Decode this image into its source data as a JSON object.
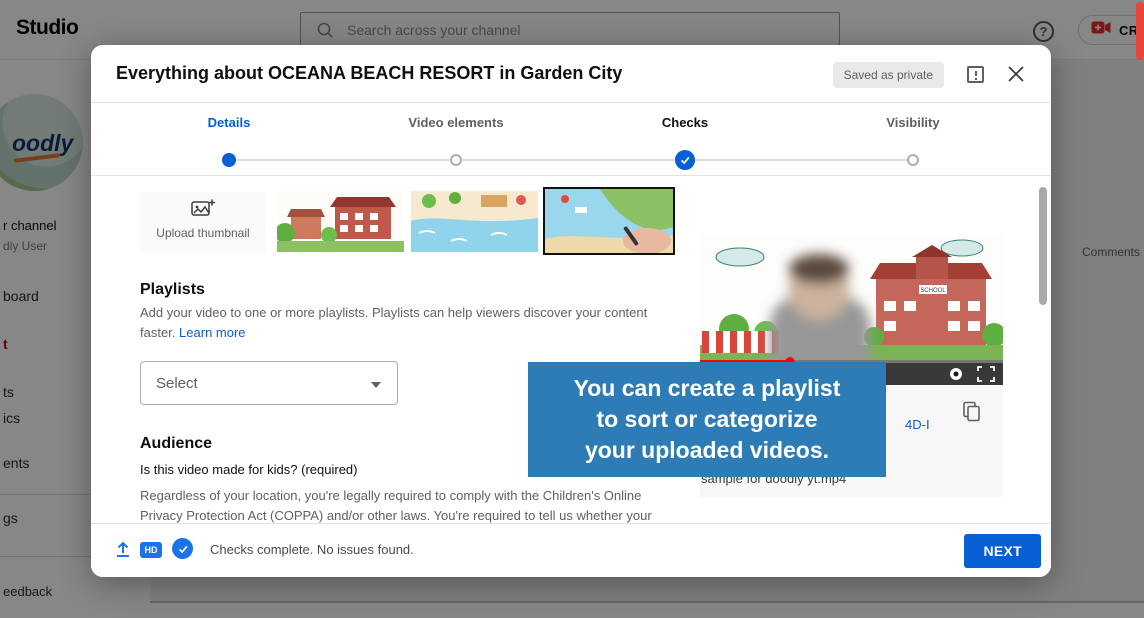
{
  "colors": {
    "accent_blue": "#065fd4",
    "footer_icon_blue": "#1a73e8",
    "tooltip_blue": "#2e7cb5",
    "selected_nav_red": "#cc0000",
    "scrollbar_red": "#e8453c"
  },
  "topbar": {
    "logo": "Studio",
    "search_placeholder": "Search across your channel",
    "help_icon": "?",
    "create_label": "CREATE"
  },
  "sidebar": {
    "avatar_text": "oodly",
    "items": [
      {
        "label": "r channel"
      },
      {
        "label": "dly User"
      },
      {
        "label": "board"
      },
      {
        "label": "t"
      },
      {
        "label": "ts"
      },
      {
        "label": "ics"
      },
      {
        "label": "ents"
      },
      {
        "label": "gs"
      },
      {
        "label": "eedback"
      }
    ]
  },
  "background_content": {
    "comments_label": "Comments"
  },
  "dialog": {
    "title": "Everything about OCEANA BEACH RESORT in Garden City",
    "saved_badge": "Saved as private",
    "steps": [
      {
        "label": "Details",
        "state": "active"
      },
      {
        "label": "Video elements",
        "state": "inactive"
      },
      {
        "label": "Checks",
        "state": "complete"
      },
      {
        "label": "Visibility",
        "state": "inactive"
      }
    ],
    "upload_thumbnail_label": "Upload thumbnail",
    "playlists": {
      "heading": "Playlists",
      "description": "Add your video to one or more playlists. Playlists can help viewers discover your content faster.",
      "learn_more": "Learn more",
      "select_placeholder": "Select"
    },
    "audience": {
      "heading": "Audience",
      "question": "Is this video made for kids? (required)",
      "description": "Regardless of your location, you're legally required to comply with the Children's Online Privacy Protection Act (COPPA) and/or other laws. You're required to tell us whether your"
    },
    "video_panel": {
      "school_sign": "SCHOOL",
      "link_text": "4D-I",
      "filename": "sample for doodly yt.mp4"
    },
    "tooltip_lines": [
      "You can create a playlist",
      "to sort or categorize",
      "your uploaded videos."
    ],
    "footer": {
      "hd_label": "HD",
      "status": "Checks complete. No issues found.",
      "next_label": "NEXT"
    }
  }
}
